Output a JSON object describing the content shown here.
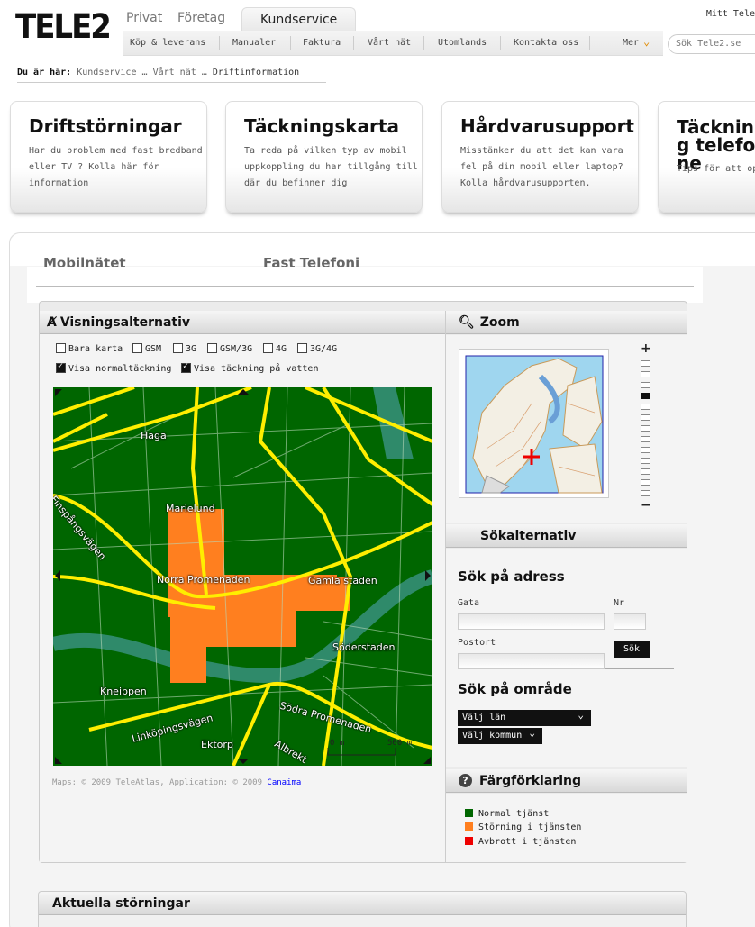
{
  "header": {
    "logo": "TELE2",
    "top_tabs": [
      "Privat",
      "Företag",
      "Kundservice"
    ],
    "subnav": [
      "Köp & leverans",
      "Manualer",
      "Faktura",
      "Vårt nät",
      "Utomlands",
      "Kontakta oss",
      "Mer"
    ],
    "mitt": "Mitt Tele",
    "search_placeholder": "Sök Tele2.se"
  },
  "breadcrumb": {
    "prefix": "Du är här:",
    "items": [
      "Kundservice",
      "Vårt nät",
      "Driftinformation"
    ],
    "separator": "…"
  },
  "cards": [
    {
      "title": "Driftstörningar",
      "text": "Har du problem med fast bredband eller TV ? Kolla här för information"
    },
    {
      "title": "Täckningskarta",
      "text": "Ta reda på vilken typ av mobil uppkoppling du har tillgång till där du befinner dig"
    },
    {
      "title": "Hårdvarusupport",
      "text": "Misstänker du att det kan vara fel på din mobil eller laptop? Kolla hårdvarusupporten."
    },
    {
      "title": "Täckning telefone",
      "text": "Tips för att op mobilanvändand"
    }
  ],
  "main_tabs": [
    "Mobilnätet",
    "Fast Telefoni"
  ],
  "view_options": {
    "title": "Visningsalternativ",
    "checkboxes": [
      {
        "label": "Bara karta",
        "state": "off"
      },
      {
        "label": "GSM",
        "state": "off"
      },
      {
        "label": "3G",
        "state": "off"
      },
      {
        "label": "GSM/3G",
        "state": "off"
      },
      {
        "label": "4G",
        "state": "off"
      },
      {
        "label": "3G/4G",
        "state": "off"
      },
      {
        "label": "Visa normaltäckning",
        "state": "on"
      },
      {
        "label": "Visa täckning på vatten",
        "state": "on"
      }
    ]
  },
  "map": {
    "labels": [
      "Haga",
      "Marielund",
      "Finspångsvägen",
      "Norra Promenaden",
      "Gamla staden",
      "Söderstaden",
      "Kneippen",
      "Linköpingsvägen",
      "Södra Promenaden",
      "Ektorp",
      "Albrekt"
    ],
    "scale_labels": [
      "0 m",
      "500 m"
    ],
    "copyright_text": "Maps: © 2009 TeleAtlas, Application: © 2009",
    "copyright_link": "Canaima"
  },
  "zoom": {
    "title": "Zoom",
    "plus": "+",
    "minus": "−",
    "levels": 13,
    "current_level": 4
  },
  "search": {
    "title": "Sökalternativ",
    "address_heading": "Sök på adress",
    "street_label": "Gata",
    "number_label": "Nr",
    "postal_label": "Postort",
    "button": "Sök",
    "area_heading": "Sök på område",
    "county_select": "Välj län",
    "municipality_select": "Välj kommun"
  },
  "legend": {
    "title": "Färgförklaring",
    "items": [
      {
        "label": "Normal tjänst",
        "color": "#006600"
      },
      {
        "label": "Störning i tjänsten",
        "color": "#ff7f1f"
      },
      {
        "label": "Avbrott i tjänsten",
        "color": "#ee0000"
      }
    ]
  },
  "current_issues": {
    "title": "Aktuella störningar"
  }
}
